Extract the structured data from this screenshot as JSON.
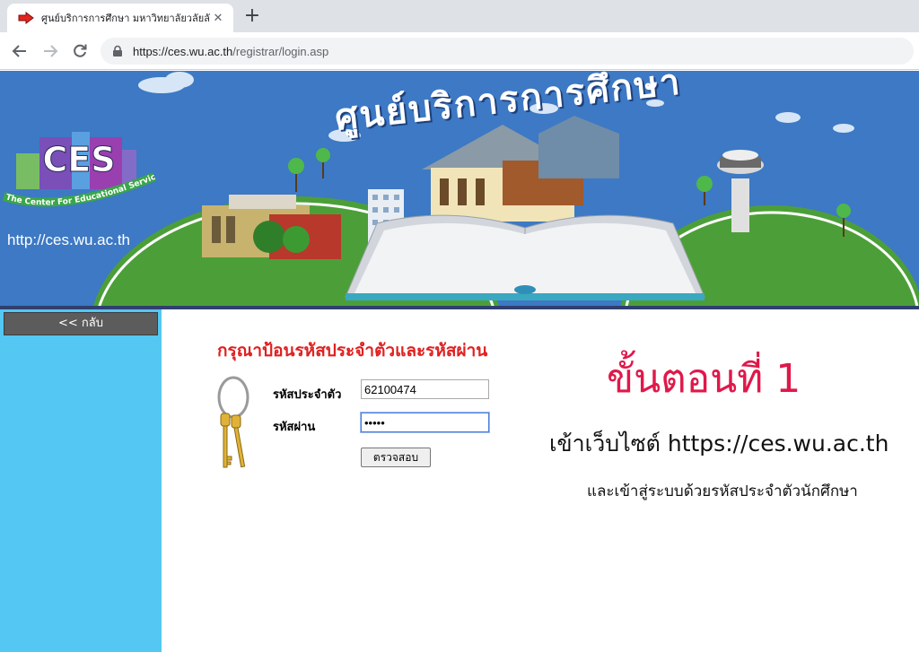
{
  "browser": {
    "tab_title": "ศูนย์บริการการศึกษา มหาวิทยาลัยวลัยลักษณ์",
    "tab_close": "✕",
    "new_tab": "+",
    "url_host": "https://ces.wu.ac.th",
    "url_path": "/registrar/login.asp"
  },
  "banner": {
    "title": "ศูนย์บริการการศึกษา",
    "logo_text": "CES",
    "logo_tagline": "The Center For Educational Services",
    "url": "http://ces.wu.ac.th"
  },
  "sidebar": {
    "back_label": "<< กลับ"
  },
  "login": {
    "heading": "กรุณาป้อนรหัสประจำตัวและรหัสผ่าน",
    "id_label": "รหัสประจำตัว",
    "id_value": "62100474",
    "password_label": "รหัสผ่าน",
    "password_value": "•••••",
    "submit_label": "ตรวจสอบ"
  },
  "instructions": {
    "step_title": "ขั้นตอนที่ 1",
    "line1": "เข้าเว็บไซต์  https://ces.wu.ac.th",
    "line2": "และเข้าสู่ระบบด้วยรหัสประจำตัวนักศึกษา"
  },
  "colors": {
    "banner_bg": "#3d79c4",
    "sidebar_bg": "#54c7f2",
    "heading_red": "#e02020",
    "step_red": "#e0184a"
  },
  "icons": [
    "arrow-favicon-icon",
    "back-arrow-icon",
    "forward-arrow-icon",
    "reload-icon",
    "lock-icon",
    "keys-icon"
  ]
}
